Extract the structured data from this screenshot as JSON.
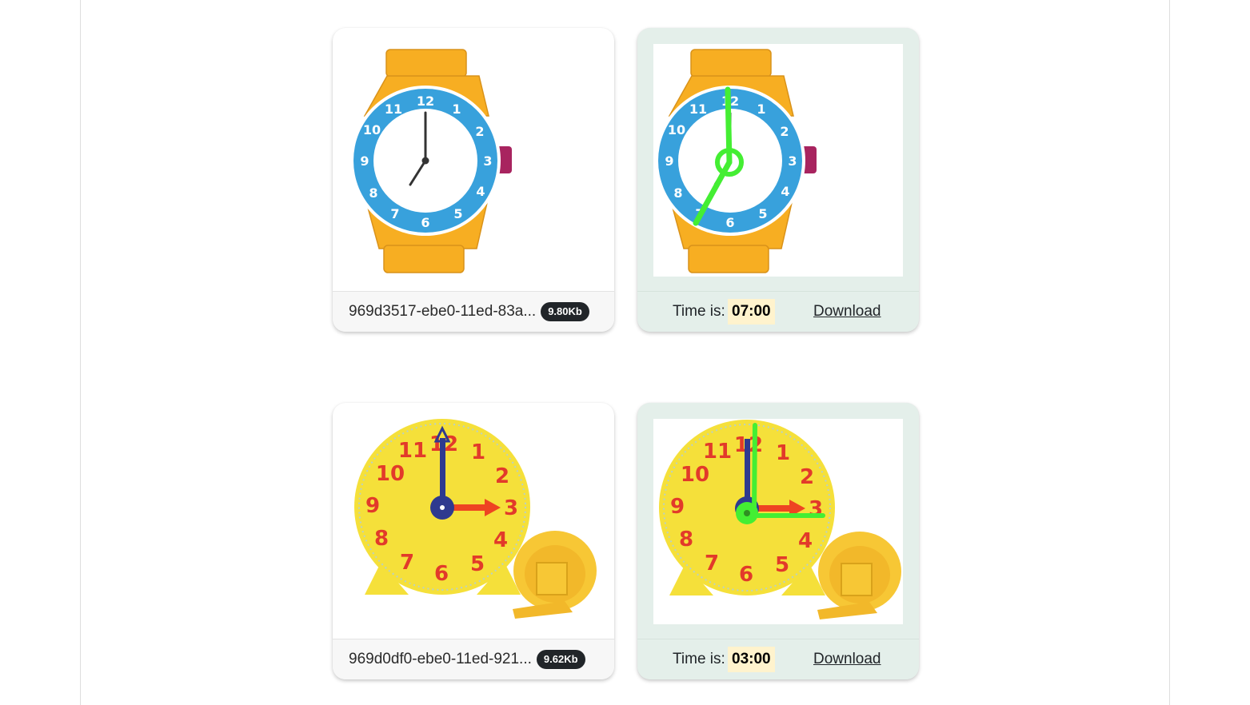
{
  "results": [
    {
      "input": {
        "filename": "969d3517-ebe0-11ed-83a...",
        "size": "9.80Kb",
        "image": "wristwatch-clock-image"
      },
      "output": {
        "time_label": "Time is:",
        "time": "07:00",
        "download_label": "Download",
        "image": "wristwatch-clock-annotated-image"
      }
    },
    {
      "input": {
        "filename": "969d0df0-ebe0-11ed-921...",
        "size": "9.62Kb",
        "image": "yellow-desk-clock-image"
      },
      "output": {
        "time_label": "Time is:",
        "time": "03:00",
        "download_label": "Download",
        "image": "yellow-desk-clock-annotated-image"
      }
    }
  ],
  "colors": {
    "badge_bg": "#212529",
    "result_card_bg": "#e4efea",
    "time_highlight": "#fff3cd",
    "detection_overlay": "#44ee33",
    "watch_strap": "#f7ae22",
    "watch_bezel": "#38a1dc",
    "clock_face": "#f5e03a",
    "clock_numbers": "#e23a2a"
  }
}
